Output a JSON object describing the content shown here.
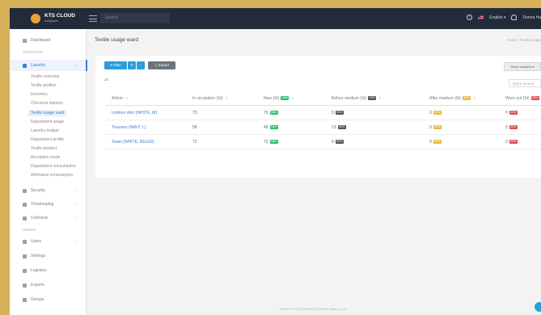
{
  "app": {
    "brand": "KTS CLOUD",
    "brand_sub": "workspace"
  },
  "topbar": {
    "search_placeholder": "Search",
    "language": "English ▾",
    "user": "Donna Ha"
  },
  "sidebar": {
    "dashboard": "Dashboard",
    "section_services": "SERVICES",
    "laundry": "Laundry",
    "laundry_items": [
      "Textile overview",
      "Textile profiles",
      "Inventory",
      "Checkout stations",
      "Textile usage ward",
      "Department usage",
      "Laundry budget",
      "Department profile",
      "Textile product",
      "Reception mode",
      "Department consumption",
      "Workwear consumption"
    ],
    "groups": [
      {
        "label": "Security"
      },
      {
        "label": "Timekeeping"
      },
      {
        "label": "Contracts"
      }
    ],
    "section_admin": "ADMIN",
    "admin_items": [
      {
        "label": "Users"
      },
      {
        "label": "Settings"
      },
      {
        "label": "Logistics"
      },
      {
        "label": "Exports"
      },
      {
        "label": "Groups"
      }
    ]
  },
  "page": {
    "title": "Textile usage ward",
    "breadcrumb": "Home  /  Textile usage"
  },
  "toolbar": {
    "filter_label": "▾ Filter",
    "x_label": "✕",
    "minus_label": "−",
    "export_label": "⇣ Export",
    "columns_label": "Show columns ▾"
  },
  "table": {
    "show_entries": "10",
    "search_placeholder": "Quick search",
    "headers": [
      "Article",
      "In circulation (St)",
      "New (St)",
      "Before medium (St)",
      "After medium (St)",
      "Worn out (St)"
    ],
    "header_badges": [
      "",
      "",
      "New",
      "90%",
      "50%",
      "20%"
    ],
    "rows": [
      {
        "article": "Uniform shirt (WHITE, M)",
        "circ": "73",
        "new": "73",
        "before": "0",
        "after": "0",
        "worn": "0"
      },
      {
        "article": "Trousers (NAVY, L)",
        "circ": "58",
        "new": "45",
        "before": "13",
        "after": "0",
        "worn": "0"
      },
      {
        "article": "Towel (WHITE, 50x100)",
        "circ": "72",
        "new": "72",
        "before": "0",
        "after": "0",
        "worn": "0"
      }
    ]
  },
  "footer": {
    "text": "2023 © KTS CLOUD by TEXTILE  version 2.14"
  }
}
